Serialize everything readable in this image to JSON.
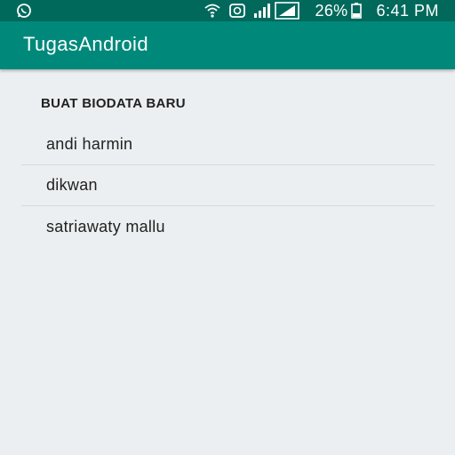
{
  "status_bar": {
    "icons": [
      "whatsapp-icon",
      "wifi-icon",
      "data-saver-icon",
      "signal-icon",
      "signal-2-icon",
      "battery-icon"
    ],
    "battery_percent": "26%",
    "time": "6:41 PM"
  },
  "app_bar": {
    "title": "TugasAndroid",
    "color": "#00897b",
    "status_color": "#00695c"
  },
  "main": {
    "section_header": "BUAT BIODATA BARU",
    "items": [
      {
        "label": "andi harmin"
      },
      {
        "label": "dikwan"
      },
      {
        "label": "satriawaty mallu"
      }
    ]
  }
}
